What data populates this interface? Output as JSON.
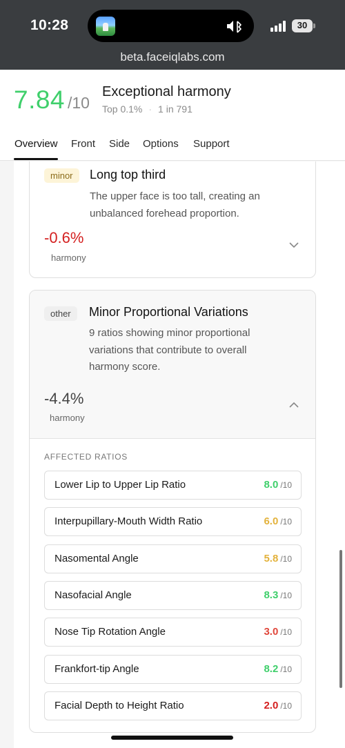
{
  "status": {
    "time": "10:28",
    "battery": "30",
    "url": "beta.faceiqlabs.com"
  },
  "header": {
    "score": "7.84",
    "score_max": "/10",
    "title": "Exceptional harmony",
    "rank_top": "Top 0.1%",
    "rank_separator": "·",
    "rank_ratio": "1 in 791"
  },
  "tabs": [
    "Overview",
    "Front",
    "Side",
    "Options",
    "Support"
  ],
  "issue_minor": {
    "badge": "minor",
    "title": "Long top third",
    "desc_line1": "The upper face is too tall, creating an",
    "desc_line2": "unbalanced forehead proportion.",
    "delta": "-0.6%",
    "delta_label": "harmony"
  },
  "issue_other": {
    "badge": "other",
    "title": "Minor Proportional Variations",
    "desc_line1": "9 ratios showing minor proportional",
    "desc_line2": "variations that contribute to overall",
    "desc_line3": "harmony score.",
    "delta": "-4.4%",
    "delta_label": "harmony",
    "affected_label": "AFFECTED RATIOS",
    "score_max": "/10",
    "ratios": [
      {
        "name": "Lower Lip to Upper Lip Ratio",
        "score": "8.0",
        "color": "#3fcf6b"
      },
      {
        "name": "Interpupillary-Mouth Width Ratio",
        "score": "6.0",
        "color": "#e3b23c"
      },
      {
        "name": "Nasomental Angle",
        "score": "5.8",
        "color": "#e3b23c"
      },
      {
        "name": "Nasofacial Angle",
        "score": "8.3",
        "color": "#3fcf6b"
      },
      {
        "name": "Nose Tip Rotation Angle",
        "score": "3.0",
        "color": "#e0463a"
      },
      {
        "name": "Frankfort-tip Angle",
        "score": "8.2",
        "color": "#3fcf6b"
      },
      {
        "name": "Facial Depth to Height Ratio",
        "score": "2.0",
        "color": "#d42020"
      }
    ]
  },
  "colors": {
    "accent_green": "#3fcf6b",
    "negative_red": "#d42020",
    "neutral_gray": "#444444"
  },
  "icons": [
    "bluetooth-icon",
    "mute-icon",
    "signal-icon",
    "battery-icon",
    "chevron-down-icon",
    "chevron-up-icon"
  ]
}
